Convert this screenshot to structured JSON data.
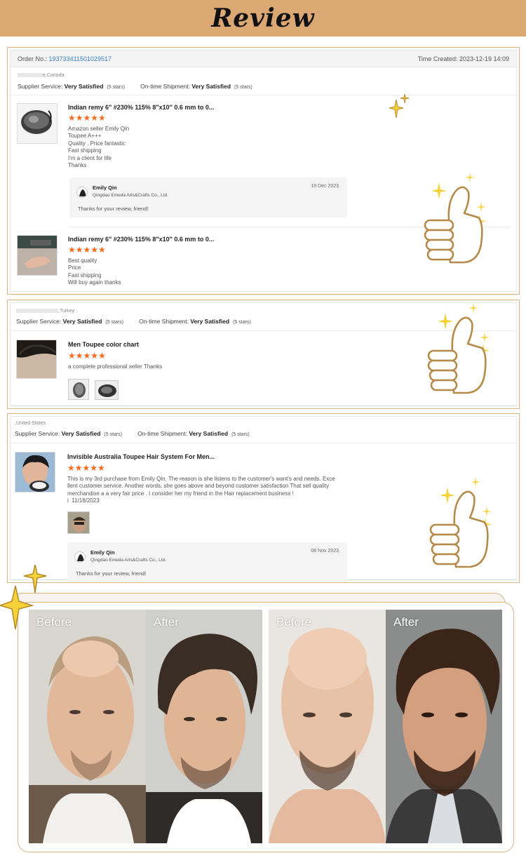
{
  "banner": {
    "title": "Review"
  },
  "colors": {
    "accent": "#f36b1c",
    "banner": "#dba873",
    "frame": "#d8b68a",
    "link": "#3b82c4",
    "sparkle": "#f5d23a"
  },
  "order": {
    "label": "Order No.:",
    "number": "193733411501029517",
    "time_label": "Time Created:",
    "time_value": "2023-12-19 14:09"
  },
  "reviews": [
    {
      "location": "e,Canada",
      "supplier_service_label": "Supplier Service:",
      "supplier_service_value": "Very Satisfied",
      "supplier_service_stars": "(5 stars)",
      "shipment_label": "On-time Shipment:",
      "shipment_value": "Very Satisfied",
      "shipment_stars": "(5 stars)",
      "items": [
        {
          "title": "Indian remy 6\" #230% 115% 8\"x10\" 0.6 mm to 0...",
          "stars": "★★★★★",
          "rating": 5,
          "text": "Amazon seller Emily Qin\nToupee A+++\nQuality , Price fantastic\nFast shipping\nI'm a client for life\nThanks",
          "reply": {
            "name": "Emily Qin",
            "company": "Qingdao Emeda Arts&Crafts Co., Ltd.",
            "date": "19 Dec 2023",
            "message": "Thanks for your review, friend!"
          }
        },
        {
          "title": "Indian remy 6\" #230% 115% 8\"x10\" 0.6 mm to 0...",
          "stars": "★★★★★",
          "rating": 5,
          "text": "Best quality\nPrice\nFast shipping\nWill buy again thanks"
        }
      ]
    },
    {
      "location": ",Turkey",
      "supplier_service_label": "Supplier Service:",
      "supplier_service_value": "Very Satisfied",
      "supplier_service_stars": "(5 stars)",
      "shipment_label": "On-time Shipment:",
      "shipment_value": "Very Satisfied",
      "shipment_stars": "(5 stars)",
      "items": [
        {
          "title": "Men Toupee color chart",
          "stars": "★★★★★",
          "rating": 5,
          "text": "a complete professional seller Thanks"
        }
      ]
    },
    {
      "location": ",United States",
      "supplier_service_label": "Supplier Service:",
      "supplier_service_value": "Very Satisfied",
      "supplier_service_stars": "(5 stars)",
      "shipment_label": "On-time Shipment:",
      "shipment_value": "Very Satisfied",
      "shipment_stars": "(5 stars)",
      "items": [
        {
          "title": "Invisible Australia Toupee Hair System For Men...",
          "stars": "★★★★★",
          "rating": 5,
          "text": "This is my 3rd purchase from Emily Qin. The reason is she listens to the customer's want's and needs. Exce\nllent customer service. Another words, she goes above and beyond customer satisfaction That sell quality\nmerchandise a a very fair price . I consider her my friend in the Hair replacement business !\ni  11/18/2023",
          "reply": {
            "name": "Emily Qin",
            "company": "Qingdao Emeda Arts&Crafts Co., Ltd.",
            "date": "08 Nov 2023",
            "message": "Thanks for your review, friend!"
          }
        }
      ]
    }
  ],
  "before_after": {
    "before_label": "Before",
    "after_label": "After"
  }
}
